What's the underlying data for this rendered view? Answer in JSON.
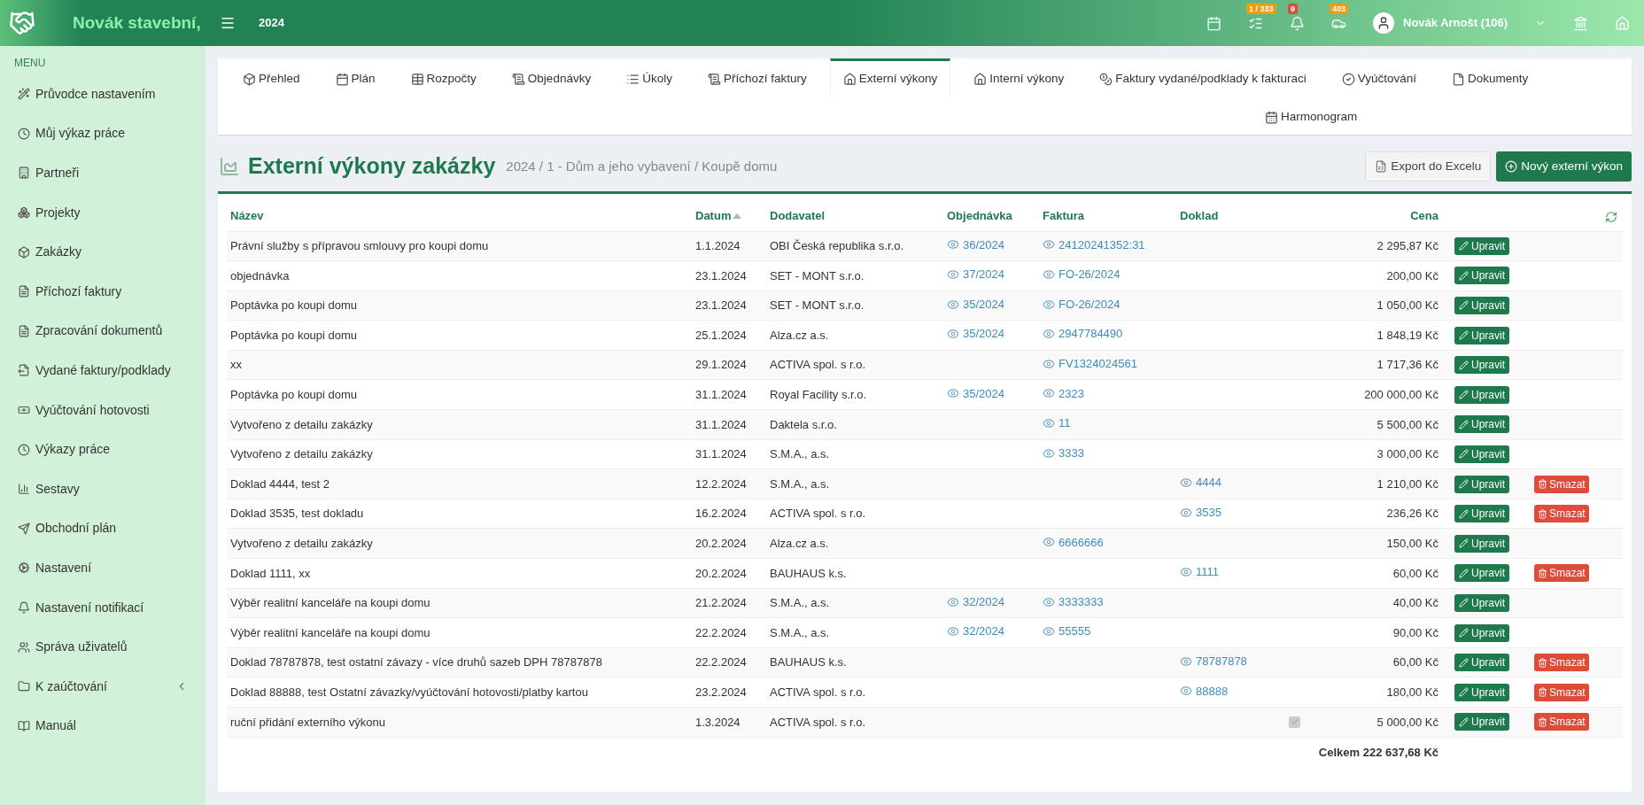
{
  "brand": {
    "name": "Novák stavební,"
  },
  "topbar": {
    "year": "2024",
    "badges": [
      {
        "kind": "calendar"
      },
      {
        "kind": "tasks",
        "badge": "1 / 333",
        "color": "#f39c12"
      },
      {
        "kind": "bell",
        "badge": "9",
        "color": "#dd4b39"
      },
      {
        "kind": "cars",
        "badge": "403",
        "color": "#f39c12"
      }
    ],
    "user": "Novák Arnošt (106)"
  },
  "sidebar": {
    "heading": "MENU",
    "items": [
      {
        "label": "Průvodce nastavením"
      },
      {
        "label": "Můj výkaz práce"
      },
      {
        "label": "Partneři"
      },
      {
        "label": "Projekty"
      },
      {
        "label": "Zakázky"
      },
      {
        "label": "Příchozí faktury"
      },
      {
        "label": "Zpracování dokumentů"
      },
      {
        "label": "Vydané faktury/podklady"
      },
      {
        "label": "Vyúčtování hotovosti"
      },
      {
        "label": "Výkazy práce"
      },
      {
        "label": "Sestavy"
      },
      {
        "label": "Obchodní plán"
      },
      {
        "label": "Nastavení"
      },
      {
        "label": "Nastavení notifikací"
      },
      {
        "label": "Správa uživatelů"
      },
      {
        "label": "K zaúčtování",
        "expanded": false
      },
      {
        "label": "Manuál"
      }
    ]
  },
  "tabs": [
    {
      "label": "Přehled",
      "selected": false
    },
    {
      "label": "Plán",
      "selected": false
    },
    {
      "label": "Rozpočty",
      "selected": false
    },
    {
      "label": "Objednávky",
      "selected": false
    },
    {
      "label": "Úkoly",
      "selected": false
    },
    {
      "label": "Příchozí faktury",
      "selected": false
    },
    {
      "label": "Externí výkony",
      "selected": true
    },
    {
      "label": "Interní výkony",
      "selected": false
    },
    {
      "label": "Faktury vydané/podklady k fakturaci",
      "selected": false
    },
    {
      "label": "Vyúčtování",
      "selected": false
    },
    {
      "label": "Dokumenty",
      "selected": false
    },
    {
      "label": "Harmonogram",
      "selected": false
    }
  ],
  "page": {
    "title": "Externí výkony zakázky",
    "breadcrumb": "2024 / 1 - Dům a jeho vybavení / Koupě domu",
    "buttons": [
      {
        "label": "Export do Excelu",
        "kind": "export"
      },
      {
        "label": "Nový externí výkon",
        "kind": "new"
      }
    ]
  },
  "table": {
    "columns": [
      "Název",
      "Datum",
      "Dodavatel",
      "Objednávka",
      "Faktura",
      "Doklad",
      "Cena"
    ],
    "rows": [
      {
        "name": "Právní služby s přípravou smlouvy pro koupi domu",
        "date": "1.1.2024",
        "supplier": "OBI Česká republika s.r.o.",
        "order": "36/2024",
        "invoice": "24120241352:31",
        "price": "2 295,87 Kč",
        "edit": "Upravit"
      },
      {
        "name": "objednávka",
        "date": "23.1.2024",
        "supplier": "SET - MONT s.r.o.",
        "order": "37/2024",
        "invoice": "FO-26/2024",
        "price": "200,00 Kč",
        "edit": "Upravit"
      },
      {
        "name": "Poptávka po koupi domu",
        "date": "23.1.2024",
        "supplier": "SET - MONT s.r.o.",
        "order": "35/2024",
        "invoice": "FO-26/2024",
        "price": "1 050,00 Kč",
        "edit": "Upravit"
      },
      {
        "name": "Poptávka po koupi domu",
        "date": "25.1.2024",
        "supplier": "Alza.cz a.s.",
        "order": "35/2024",
        "invoice": "2947784490",
        "price": "1 848,19 Kč",
        "edit": "Upravit"
      },
      {
        "name": "xx",
        "date": "29.1.2024",
        "supplier": "ACTIVA spol. s r.o.",
        "invoice": "FV1324024561",
        "price": "1 717,36 Kč",
        "edit": "Upravit"
      },
      {
        "name": "Poptávka po koupi domu",
        "date": "31.1.2024",
        "supplier": "Royal Facility s.r.o.",
        "order": "35/2024",
        "invoice": "2323",
        "price": "200 000,00 Kč",
        "edit": "Upravit"
      },
      {
        "name": "Vytvořeno z detailu zakázky",
        "date": "31.1.2024",
        "supplier": "Daktela s.r.o.",
        "invoice": "11",
        "price": "5 500,00 Kč",
        "edit": "Upravit"
      },
      {
        "name": "Vytvořeno z detailu zakázky",
        "date": "31.1.2024",
        "supplier": "S.M.A., a.s.",
        "invoice": "3333",
        "price": "3 000,00 Kč",
        "edit": "Upravit"
      },
      {
        "name": "Doklad 4444, test 2",
        "date": "12.2.2024",
        "supplier": "S.M.A., a.s.",
        "document": "4444",
        "price": "1 210,00 Kč",
        "edit": "Upravit",
        "delete": "Smazat"
      },
      {
        "name": "Doklad 3535, test dokladu",
        "date": "16.2.2024",
        "supplier": "ACTIVA spol. s r.o.",
        "document": "3535",
        "price": "236,26 Kč",
        "edit": "Upravit",
        "delete": "Smazat"
      },
      {
        "name": "Vytvořeno z detailu zakázky",
        "date": "20.2.2024",
        "supplier": "Alza.cz a.s.",
        "invoice": "6666666",
        "price": "150,00 Kč",
        "edit": "Upravit"
      },
      {
        "name": "Doklad 1111, xx",
        "date": "20.2.2024",
        "supplier": "BAUHAUS k.s.",
        "document": "1111",
        "price": "60,00 Kč",
        "edit": "Upravit",
        "delete": "Smazat"
      },
      {
        "name": "Výběr realitní kanceláře na koupi domu",
        "date": "21.2.2024",
        "supplier": "S.M.A., a.s.",
        "order": "32/2024",
        "invoice": "3333333",
        "price": "40,00 Kč",
        "edit": "Upravit"
      },
      {
        "name": "Výběr realitní kanceláře na koupi domu",
        "date": "22.2.2024",
        "supplier": "S.M.A., a.s.",
        "order": "32/2024",
        "invoice": "55555",
        "price": "90,00 Kč",
        "edit": "Upravit"
      },
      {
        "name": "Doklad 78787878, test ostatní závazy - více druhů sazeb DPH 78787878",
        "date": "22.2.2024",
        "supplier": "BAUHAUS k.s.",
        "document": "78787878",
        "price": "60,00 Kč",
        "edit": "Upravit",
        "delete": "Smazat"
      },
      {
        "name": "Doklad 88888, test Ostatní závazky/vyúčtování hotovosti/platby kartou",
        "date": "23.2.2024",
        "supplier": "ACTIVA spol. s r.o.",
        "document": "88888",
        "price": "180,00 Kč",
        "edit": "Upravit",
        "delete": "Smazat"
      },
      {
        "name": "ruční přidání externího výkonu",
        "date": "1.3.2024",
        "supplier": "ACTIVA spol. s r.o.",
        "checkbox": {
          "checked": true,
          "disabled": true
        },
        "price": "5 000,00 Kč",
        "edit": "Upravit",
        "delete": "Smazat"
      }
    ],
    "total": "Celkem 222 637,68 Kč"
  }
}
